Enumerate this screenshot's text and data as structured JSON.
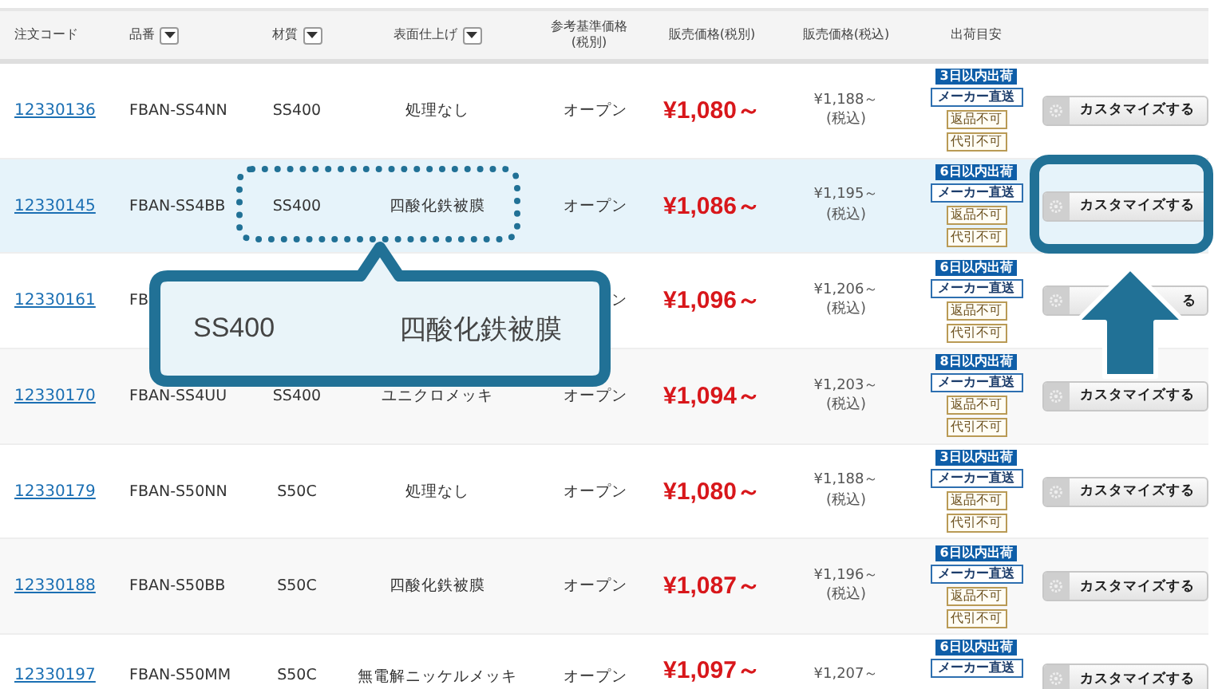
{
  "table": {
    "columns": [
      {
        "label": "注文コード",
        "filter": false
      },
      {
        "label": "品番",
        "filter": true
      },
      {
        "label": "材質",
        "filter": true
      },
      {
        "label": "表面仕上げ",
        "filter": true
      },
      {
        "label": "参考基準価格\n(税別)",
        "filter": false
      },
      {
        "label": "販売価格(税別)",
        "filter": false
      },
      {
        "label": "販売価格(税込)",
        "filter": false
      },
      {
        "label": "出荷目安",
        "filter": false
      }
    ],
    "rows": [
      {
        "code": "12330136",
        "part": "FBAN-SS4NN",
        "material": "SS400",
        "finish": "処理なし",
        "ref_price": "オープン",
        "price": "¥1,080～",
        "price_tax": "¥1,188～",
        "tax_note": "(税込)",
        "badges": [
          {
            "kind": "lead",
            "text": "3日以内出荷"
          },
          {
            "kind": "direct",
            "text": "メーカー直送"
          },
          {
            "kind": "note",
            "text": "返品不可"
          },
          {
            "kind": "note",
            "text": "代引不可"
          }
        ],
        "button": "カスタマイズする",
        "selected": false
      },
      {
        "code": "12330145",
        "part": "FBAN-SS4BB",
        "material": "SS400",
        "finish": "四酸化鉄被膜",
        "ref_price": "オープン",
        "price": "¥1,086～",
        "price_tax": "¥1,195～",
        "tax_note": "(税込)",
        "badges": [
          {
            "kind": "lead",
            "text": "6日以内出荷"
          },
          {
            "kind": "direct",
            "text": "メーカー直送"
          },
          {
            "kind": "note",
            "text": "返品不可"
          },
          {
            "kind": "note",
            "text": "代引不可"
          }
        ],
        "button": "カスタマイズする",
        "selected": true
      },
      {
        "code": "12330161",
        "part": "FB",
        "ref_price": "ン",
        "price": "¥1,096～",
        "price_tax": "¥1,206～",
        "tax_note": "(税込)",
        "badges": [
          {
            "kind": "lead",
            "text": "6日以内出荷"
          },
          {
            "kind": "direct",
            "text": "メーカー直送"
          },
          {
            "kind": "note",
            "text": "返品不可"
          },
          {
            "kind": "note",
            "text": "代引不可"
          }
        ],
        "button": "る",
        "selected": false
      },
      {
        "code": "12330170",
        "part": "FBAN-SS4UU",
        "material": "SS400",
        "finish": "ユニクロメッキ",
        "ref_price": "オープン",
        "price": "¥1,094～",
        "price_tax": "¥1,203～",
        "tax_note": "(税込)",
        "badges": [
          {
            "kind": "lead",
            "text": "8日以内出荷"
          },
          {
            "kind": "direct",
            "text": "メーカー直送"
          },
          {
            "kind": "note",
            "text": "返品不可"
          },
          {
            "kind": "note",
            "text": "代引不可"
          }
        ],
        "button": "カスタマイズする",
        "selected": false
      },
      {
        "code": "12330179",
        "part": "FBAN-S50NN",
        "material": "S50C",
        "finish": "処理なし",
        "ref_price": "オープン",
        "price": "¥1,080～",
        "price_tax": "¥1,188～",
        "tax_note": "(税込)",
        "badges": [
          {
            "kind": "lead",
            "text": "3日以内出荷"
          },
          {
            "kind": "direct",
            "text": "メーカー直送"
          },
          {
            "kind": "note",
            "text": "返品不可"
          },
          {
            "kind": "note",
            "text": "代引不可"
          }
        ],
        "button": "カスタマイズする",
        "selected": false
      },
      {
        "code": "12330188",
        "part": "FBAN-S50BB",
        "material": "S50C",
        "finish": "四酸化鉄被膜",
        "ref_price": "オープン",
        "price": "¥1,087～",
        "price_tax": "¥1,196～",
        "tax_note": "(税込)",
        "badges": [
          {
            "kind": "lead",
            "text": "6日以内出荷"
          },
          {
            "kind": "direct",
            "text": "メーカー直送"
          },
          {
            "kind": "note",
            "text": "返品不可"
          },
          {
            "kind": "note",
            "text": "代引不可"
          }
        ],
        "button": "カスタマイズする",
        "selected": false
      },
      {
        "code": "12330197",
        "part": "FBAN-S50MM",
        "material": "S50C",
        "finish": "無電解ニッケルメッキ",
        "ref_price": "オープン",
        "price": "¥1,097～",
        "price_tax": "¥1,207～",
        "badges": [
          {
            "kind": "lead",
            "text": "6日以内出荷"
          },
          {
            "kind": "direct",
            "text": "メーカー直送"
          }
        ],
        "button": "カスタマイズする",
        "selected": false
      }
    ]
  },
  "callout": {
    "material": "SS400",
    "finish": "四酸化鉄被膜"
  }
}
